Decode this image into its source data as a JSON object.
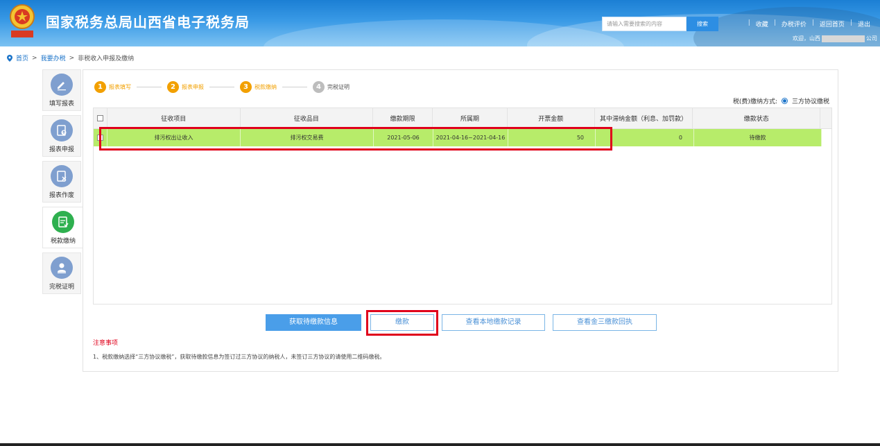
{
  "header": {
    "site_title": "国家税务总局山西省电子税务局",
    "search_placeholder": "请输入需要搜索的内容",
    "search_button": "搜索",
    "links": [
      "收藏",
      "办税评价",
      "返回首页",
      "退出"
    ],
    "welcome_prefix": "欢迎，山西",
    "welcome_suffix": "公司"
  },
  "breadcrumb": {
    "home": "首页",
    "separator": ">",
    "section": "我要办税",
    "current": "非税收入申报及缴纳"
  },
  "sidebar": {
    "items": [
      {
        "label": "填写报表",
        "icon": "edit-icon"
      },
      {
        "label": "报表申报",
        "icon": "upload-report-icon"
      },
      {
        "label": "报表作废",
        "icon": "void-report-icon"
      },
      {
        "label": "税款缴纳",
        "icon": "tax-payment-icon"
      },
      {
        "label": "完税证明",
        "icon": "certificate-icon"
      }
    ],
    "active_index": 3
  },
  "steps": [
    {
      "num": "1",
      "label": "报表填写",
      "state": "done"
    },
    {
      "num": "2",
      "label": "报表申报",
      "state": "done"
    },
    {
      "num": "3",
      "label": "税款缴纳",
      "state": "current"
    },
    {
      "num": "4",
      "label": "完税证明",
      "state": "todo"
    }
  ],
  "pay_method": {
    "label": "税(费)缴纳方式:",
    "option": "三方协议缴税"
  },
  "table": {
    "headers": [
      "征收项目",
      "征收品目",
      "缴款期限",
      "所属期",
      "开票金额",
      "其中滞纳金额（利息、加罚款）",
      "缴款状态"
    ],
    "rows": [
      [
        "排污权出让收入",
        "排污权交易费",
        "2021-05-06",
        "2021-04-16~2021-04-16",
        "50",
        "0",
        "待缴款"
      ]
    ]
  },
  "buttons": {
    "fetch": "获取待缴款信息",
    "pay": "缴款",
    "local_records": "查看本地缴款记录",
    "tripartite_receipts": "查看金三缴款回执"
  },
  "notes": {
    "title": "注意事项",
    "text": "1、税款缴纳选择“三方协议缴税”，获取待缴款信息为签订过三方协议的纳税人，未签订三方协议的请使用二维码缴税。"
  },
  "colors": {
    "header_blue": "#1b7fd4",
    "row_highlight": "#b7ec6a",
    "step_orange": "#f2a000",
    "annotation_red": "#e0001b",
    "active_green": "#2eb04f"
  }
}
